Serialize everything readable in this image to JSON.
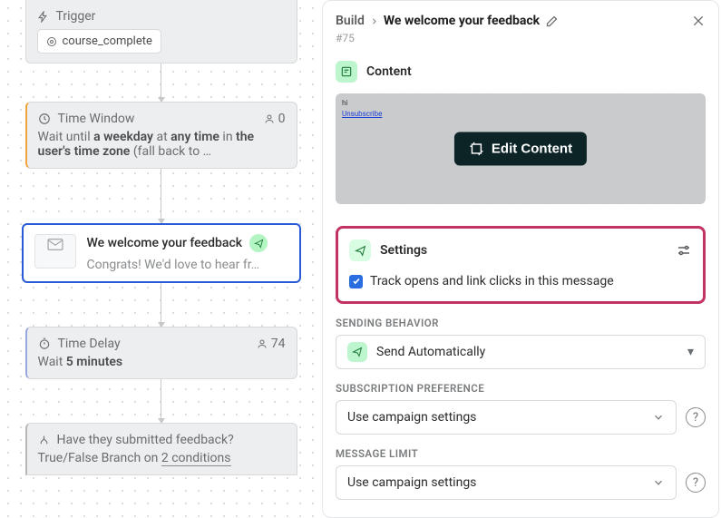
{
  "flow": {
    "trigger": {
      "title": "Trigger",
      "tag": "course_complete"
    },
    "timeWindow": {
      "title": "Time Window",
      "people": "0",
      "line1_pre": "Wait until ",
      "line1_b1": "a weekday",
      "line1_mid": " at ",
      "line1_b2": "any time",
      "line1_post": " in ",
      "line1_b3": "the",
      "line2_b1": "user's time zone",
      "line2_post": " (fall back to …"
    },
    "message": {
      "title": "We welcome your feedback",
      "preview": "Congrats! We'd love to hear fr…"
    },
    "timeDelay": {
      "title": "Time Delay",
      "people": "74",
      "line_pre": "Wait ",
      "line_b": "5 minutes"
    },
    "branch": {
      "title": "Have they submitted feedback?",
      "line_pre": "True/False Branch on ",
      "line_link": "2 conditions"
    }
  },
  "panel": {
    "crumb": "Build",
    "title": "We welcome your feedback",
    "id": "#75",
    "contentLabel": "Content",
    "preview_hi": "hi",
    "preview_unsub": "Unsubscribe",
    "editBtn": "Edit Content",
    "settingsLabel": "Settings",
    "trackLabel": "Track opens and link clicks in this message",
    "sendingBehaviorLabel": "SENDING BEHAVIOR",
    "sendingBehaviorValue": "Send Automatically",
    "subPrefLabel": "SUBSCRIPTION PREFERENCE",
    "subPrefValue": "Use campaign settings",
    "msgLimitLabel": "MESSAGE LIMIT",
    "msgLimitValue": "Use campaign settings"
  }
}
